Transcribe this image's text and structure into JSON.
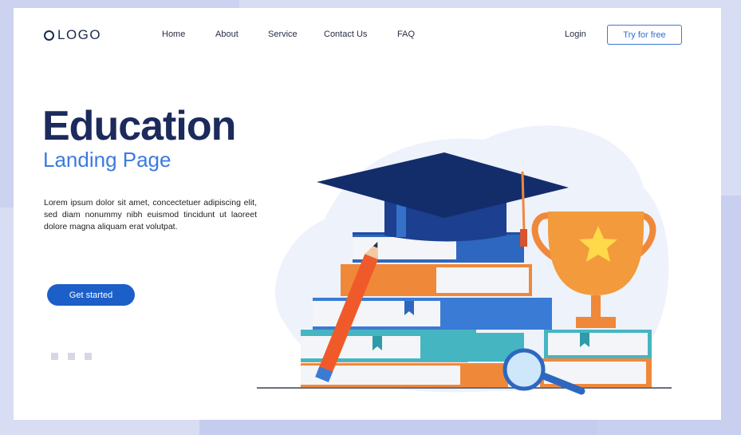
{
  "header": {
    "logo_text": "LOGO",
    "nav": [
      "Home",
      "About",
      "Service",
      "Contact Us",
      "FAQ"
    ],
    "login_label": "Login",
    "cta_label": "Try for free"
  },
  "hero": {
    "title": "Education",
    "subtitle": "Landing Page",
    "description": "Lorem ipsum dolor sit amet, concectetuer adipiscing elit, sed diam nonummy nibh euismod tincidunt ut laoreet dolore magna aliquam erat volutpat.",
    "cta_label": "Get started"
  },
  "carousel": {
    "dot_count": 3
  },
  "colors": {
    "brand_dark": "#1c2a5c",
    "brand_blue": "#3b7be0",
    "button_blue": "#1c5fc9",
    "orange": "#f0883a",
    "teal": "#46b5c2"
  },
  "icons": [
    "logo-circle-icon",
    "graduation-cap-icon",
    "trophy-icon",
    "star-icon",
    "pencil-icon",
    "magnifier-icon",
    "books-stack-icon"
  ]
}
